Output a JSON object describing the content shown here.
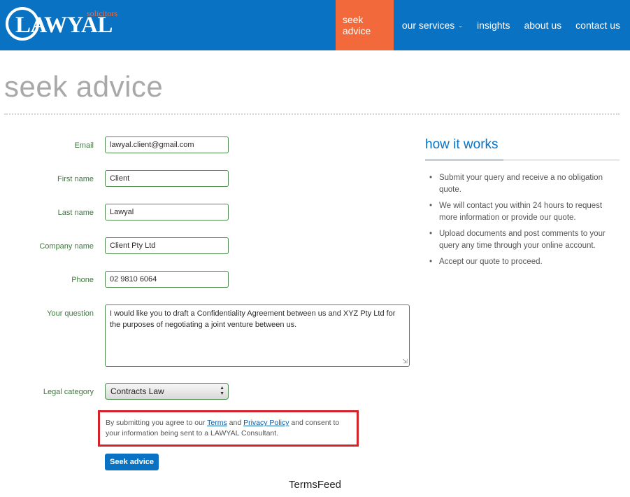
{
  "header": {
    "logo_text": "LAWYAL",
    "logo_tagline": "solicitors",
    "nav": [
      {
        "label": "seek advice"
      },
      {
        "label": "our services"
      },
      {
        "label": "insights"
      },
      {
        "label": "about us"
      },
      {
        "label": "contact us"
      }
    ]
  },
  "page": {
    "title": "seek advice"
  },
  "form": {
    "email": {
      "label": "Email",
      "value": "lawyal.client@gmail.com"
    },
    "first_name": {
      "label": "First name",
      "value": "Client"
    },
    "last_name": {
      "label": "Last name",
      "value": "Lawyal"
    },
    "company": {
      "label": "Company name",
      "value": "Client Pty Ltd"
    },
    "phone": {
      "label": "Phone",
      "value": "02 9810 6064"
    },
    "question": {
      "label": "Your question",
      "value": "I would like you to draft a Confidentiality Agreement between us and XYZ Pty Ltd for the purposes of negotiating a joint venture between us."
    },
    "category": {
      "label": "Legal category",
      "value": "Contracts Law"
    },
    "consent": {
      "prefix": "By submitting you agree to our ",
      "terms_link": "Terms",
      "middle": " and ",
      "privacy_link": "Privacy Policy",
      "suffix": " and consent to your information being sent to a LAWYAL Consultant."
    },
    "submit_label": "Seek advice"
  },
  "sidebar": {
    "title": "how it works",
    "items": [
      "Submit your query and receive a no obligation quote.",
      "We will contact you within 24 hours to request more information or provide our quote.",
      "Upload documents and post comments to your query any time through your online account.",
      "Accept our quote to proceed."
    ]
  },
  "footer": {
    "brand": "TermsFeed"
  },
  "colors": {
    "header_blue": "#0a72c2",
    "active_orange": "#f26a3b",
    "field_green": "#4d8a4d",
    "notice_red": "#d4242b"
  }
}
